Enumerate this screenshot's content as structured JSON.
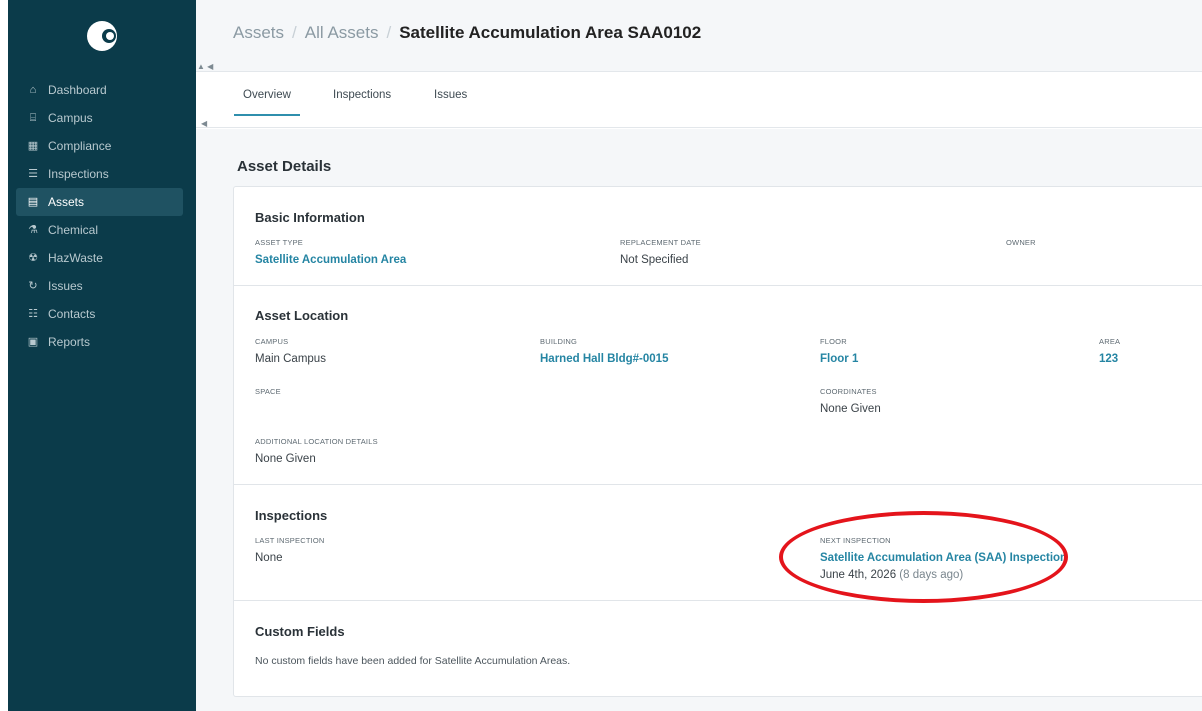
{
  "sidebar": {
    "logo_icon": "crescent-logo-icon",
    "items": [
      {
        "label": "Dashboard",
        "icon": "home-icon",
        "glyph": "⌂"
      },
      {
        "label": "Campus",
        "icon": "campus-icon",
        "glyph": "⌸"
      },
      {
        "label": "Compliance",
        "icon": "calendar-icon",
        "glyph": "▦"
      },
      {
        "label": "Inspections",
        "icon": "checklist-icon",
        "glyph": "☰"
      },
      {
        "label": "Assets",
        "icon": "assets-icon",
        "glyph": "▤"
      },
      {
        "label": "Chemical",
        "icon": "flask-icon",
        "glyph": "⚗"
      },
      {
        "label": "HazWaste",
        "icon": "hazard-icon",
        "glyph": "☢"
      },
      {
        "label": "Issues",
        "icon": "refresh-icon",
        "glyph": "↻"
      },
      {
        "label": "Contacts",
        "icon": "contacts-icon",
        "glyph": "☷"
      },
      {
        "label": "Reports",
        "icon": "report-icon",
        "glyph": "▣"
      }
    ],
    "active_index": 4
  },
  "breadcrumb": {
    "items": [
      "Assets",
      "All Assets"
    ],
    "current": "Satellite Accumulation Area SAA0102",
    "separator": "/"
  },
  "tabs": {
    "items": [
      "Overview",
      "Inspections",
      "Issues"
    ],
    "active": "Overview"
  },
  "asset_details": {
    "title": "Asset Details",
    "basic": {
      "title": "Basic Information",
      "asset_type_label": "ASSET TYPE",
      "asset_type": "Satellite Accumulation Area",
      "replacement_date_label": "REPLACEMENT DATE",
      "replacement_date": "Not Specified",
      "owner_label": "OWNER"
    },
    "location": {
      "title": "Asset Location",
      "campus_label": "CAMPUS",
      "campus": "Main Campus",
      "building_label": "BUILDING",
      "building": "Harned Hall Bldg#-0015",
      "floor_label": "FLOOR",
      "floor": "Floor 1",
      "area_label": "AREA",
      "area": "123",
      "space_label": "SPACE",
      "coordinates_label": "COORDINATES",
      "coordinates": "None Given",
      "additional_label": "ADDITIONAL LOCATION DETAILS",
      "additional": "None Given"
    },
    "inspections": {
      "title": "Inspections",
      "last_label": "LAST INSPECTION",
      "last": "None",
      "next_label": "NEXT INSPECTION",
      "next_name": "Satellite Accumulation Area (SAA) Inspection",
      "next_date": "June 4th, 2026",
      "next_relative": "(8 days ago)"
    },
    "custom": {
      "title": "Custom Fields",
      "note": "No custom fields have been added for Satellite Accumulation Areas."
    }
  },
  "colors": {
    "sidebar_bg": "#0b3b4a",
    "accent": "#2585a3",
    "highlight": "#e4141b"
  }
}
